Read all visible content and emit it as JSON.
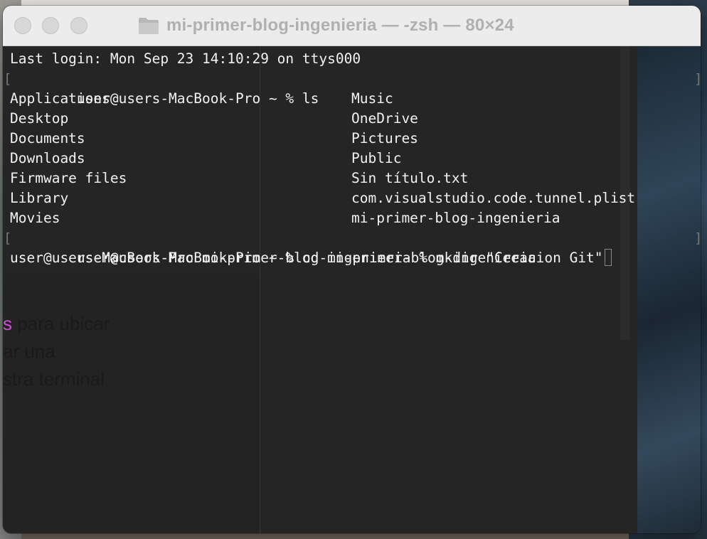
{
  "window": {
    "title": "mi-primer-blog-ingenieria — -zsh — 80×24"
  },
  "terminal": {
    "last_login": "Last login: Mon Sep 23 14:10:29 on ttys000",
    "prompt1": "user@users-MacBook-Pro ~ % ls",
    "ls_col1": [
      "Applications",
      "Desktop",
      "Documents",
      "Downloads",
      "Firmware files",
      "Library",
      "Movies"
    ],
    "ls_col2": [
      "Music",
      "OneDrive",
      "Pictures",
      "Public",
      "Sin título.txt",
      "com.visualstudio.code.tunnel.plist",
      "mi-primer-blog-ingenieria"
    ],
    "prompt2": "user@users-MacBook-Pro ~ % cd mi-primer-blog-ingenieria",
    "prompt3": "user@users-MacBook-Pro mi-primer-blog-ingenieria % mkdir \"Creacion Git\""
  },
  "background_doc": {
    "line1_mark": "s",
    "line1": " para ubicar",
    "line2": "ar una",
    "line3": "stra terminal"
  },
  "icons": {
    "folder": "folder-icon"
  },
  "colors": {
    "terminal_bg": "#252525",
    "terminal_fg": "#f2f2f2",
    "titlebar_bg": "#ececec"
  }
}
